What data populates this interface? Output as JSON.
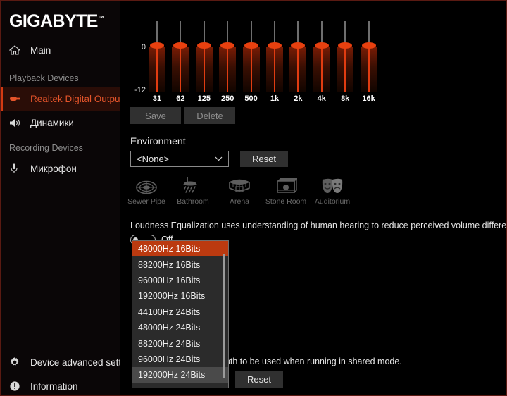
{
  "window": {
    "brand": "GIGABYTE",
    "brand_tm": "™",
    "accent_color": "#e4542a",
    "selected_row_bg": "#2a0d07",
    "controls": [
      {
        "name": "minimize",
        "glyph": "–"
      },
      {
        "name": "maximize",
        "glyph": "□"
      },
      {
        "name": "close",
        "glyph": "✕"
      }
    ]
  },
  "sidebar": {
    "main_item": {
      "label": "Main",
      "icon": "home-icon"
    },
    "groups": [
      {
        "label": "Playback Devices",
        "items": [
          {
            "label": "Realtek Digital Output",
            "icon": "spdif-plug-icon",
            "selected": true
          },
          {
            "label": "Динамики",
            "icon": "speaker-icon",
            "selected": false
          }
        ]
      },
      {
        "label": "Recording Devices",
        "items": [
          {
            "label": "Микрофон",
            "icon": "microphone-icon",
            "selected": false
          }
        ]
      }
    ],
    "footer": [
      {
        "label": "Device advanced settings",
        "icon": "gear-icon"
      },
      {
        "label": "Information",
        "icon": "info-icon"
      }
    ]
  },
  "equalizer": {
    "top_label": "0",
    "bottom_label": "-12",
    "bands": [
      {
        "freq": "31",
        "value": 0
      },
      {
        "freq": "62",
        "value": 0
      },
      {
        "freq": "125",
        "value": 0
      },
      {
        "freq": "250",
        "value": 0
      },
      {
        "freq": "500",
        "value": 0
      },
      {
        "freq": "1k",
        "value": 0
      },
      {
        "freq": "2k",
        "value": 0
      },
      {
        "freq": "4k",
        "value": 0
      },
      {
        "freq": "8k",
        "value": 0
      },
      {
        "freq": "16k",
        "value": 0
      }
    ],
    "save_label": "Save",
    "delete_label": "Delete"
  },
  "environment": {
    "title": "Environment",
    "selected": "<None>",
    "chevron": "⌄",
    "reset_label": "Reset",
    "presets": [
      {
        "label": "Sewer Pipe",
        "icon": "sewer-pipe-icon"
      },
      {
        "label": "Bathroom",
        "icon": "shower-icon"
      },
      {
        "label": "Arena",
        "icon": "arena-icon"
      },
      {
        "label": "Stone Room",
        "icon": "stone-room-icon"
      },
      {
        "label": "Auditorium",
        "icon": "theater-masks-icon"
      }
    ]
  },
  "loudness": {
    "description": "Loudness Equalization uses understanding of human hearing to reduce perceived volume differences.",
    "toggle_state": "Off"
  },
  "default_format": {
    "description_tail": "depth to be used when running in shared mode.",
    "reset_label": "Reset",
    "options": [
      {
        "label": "48000Hz 16Bits",
        "state": "selected"
      },
      {
        "label": "88200Hz 16Bits",
        "state": "normal"
      },
      {
        "label": "96000Hz 16Bits",
        "state": "normal"
      },
      {
        "label": "192000Hz 16Bits",
        "state": "normal"
      },
      {
        "label": "44100Hz 24Bits",
        "state": "normal"
      },
      {
        "label": "48000Hz 24Bits",
        "state": "normal"
      },
      {
        "label": "88200Hz 24Bits",
        "state": "normal"
      },
      {
        "label": "96000Hz 24Bits",
        "state": "normal"
      },
      {
        "label": "192000Hz 24Bits",
        "state": "hover"
      }
    ]
  }
}
